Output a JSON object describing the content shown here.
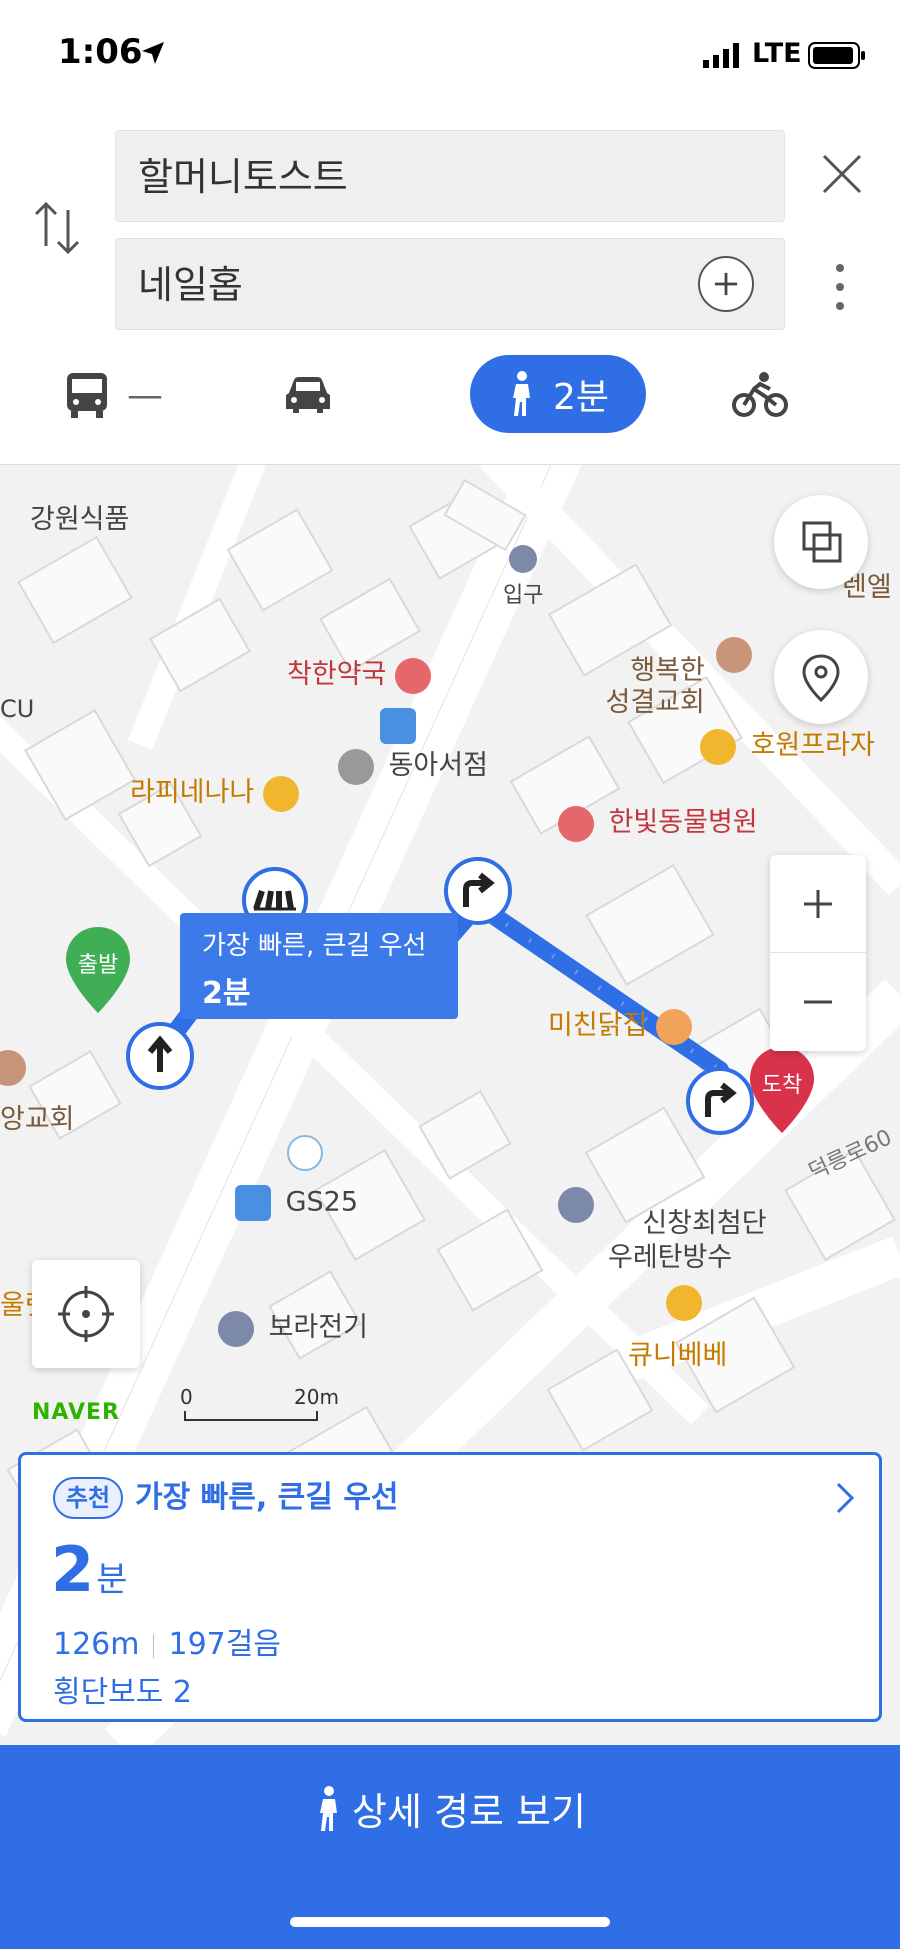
{
  "status_bar": {
    "time": "1:06",
    "network": "LTE"
  },
  "search": {
    "origin": "할머니토스트",
    "destination": "네일홉"
  },
  "modes": {
    "bus_time": "—",
    "walk_time": "2분"
  },
  "map": {
    "pois": {
      "gangwon": "강원식품",
      "entrance": "입구",
      "haengbok": "행복한\n성결교회",
      "chakhan": "착한약국",
      "cu": "CU",
      "dongah": "동아서점",
      "hoewon": "호원프라자",
      "rapi": "라피네나나",
      "hanbit": "한빛동물병원",
      "michin": "미친닭집",
      "church_left": "앙교회",
      "gs25": "GS25",
      "sinchang": "신창최첨단\n우레탄방수",
      "bora": "보라전기",
      "kyuni": "큐니베베",
      "road": "덕릉로60",
      "edge_top": "렌엘",
      "edge_left": "울렛"
    },
    "markers": {
      "start": "출발",
      "end": "도착"
    },
    "tip": {
      "title": "가장 빠른, 큰길 우선",
      "time": "2분"
    },
    "scale": {
      "zero": "0",
      "distance": "20m"
    },
    "logo": "NAVER"
  },
  "route_card": {
    "badge": "추천",
    "title": "가장 빠른, 큰길 우선",
    "time_num": "2",
    "time_unit": "분",
    "distance": "126m",
    "steps": "197걸음",
    "crosswalk": "횡단보도 2"
  },
  "detail_button": {
    "label": "상세 경로 보기"
  },
  "colors": {
    "accent": "#2f6ee5",
    "start_marker": "#3fae55",
    "end_marker": "#d8334a"
  }
}
